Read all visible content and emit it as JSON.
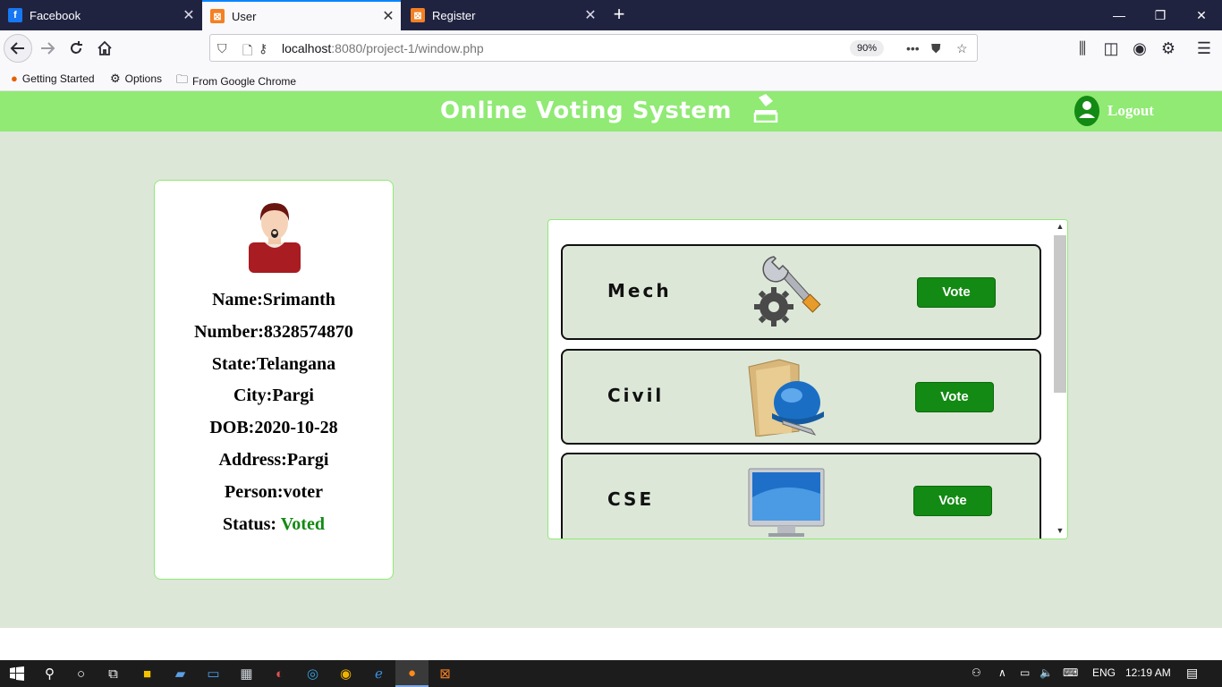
{
  "browser": {
    "tabs": [
      {
        "label": "Facebook",
        "icon": "facebook-icon",
        "active": false
      },
      {
        "label": "User",
        "icon": "xampp-icon",
        "active": true
      },
      {
        "label": "Register",
        "icon": "xampp-icon",
        "active": false
      }
    ],
    "url": {
      "host": "localhost",
      "path": ":8080/project-1/window.php"
    },
    "zoom": "90%",
    "bookmarks": [
      {
        "label": "Getting Started",
        "icon": "firefox-icon"
      },
      {
        "label": "Options",
        "icon": "gear-icon"
      },
      {
        "label": "From Google Chrome",
        "icon": "folder-icon"
      }
    ]
  },
  "site": {
    "title": "Online Voting System",
    "logout_label": "Logout",
    "colors": {
      "header": "#90ea74",
      "background": "#dce7d8",
      "vote_button": "#138a13",
      "voted_status": "#138a13"
    }
  },
  "profile": {
    "name": "Name:Srimanth",
    "number": "Number:8328574870",
    "state": "State:Telangana",
    "city": "City:Pargi",
    "dob": "DOB:2020-10-28",
    "address": "Address:Pargi",
    "person": "Person:voter",
    "status_label": "Status: ",
    "status_value": "Voted"
  },
  "candidates": [
    {
      "name": "Mech",
      "image": "tools-gear-icon",
      "button": "Vote"
    },
    {
      "name": "Civil",
      "image": "folder-helmet-icon",
      "button": "Vote"
    },
    {
      "name": "CSE",
      "image": "monitor-icon",
      "button": "Vote"
    }
  ],
  "taskbar": {
    "language": "ENG",
    "time": "12:19 AM"
  }
}
